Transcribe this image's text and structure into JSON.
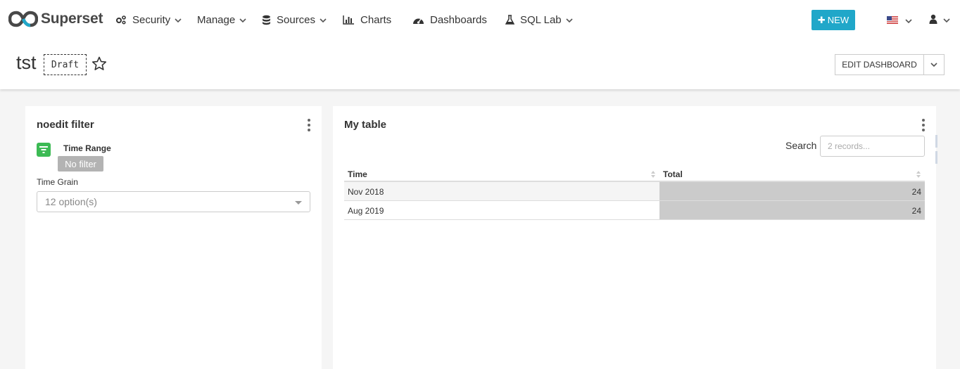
{
  "navbar": {
    "brand": "Superset",
    "items": [
      {
        "label": "Security",
        "icon": "cogs-icon",
        "has_dropdown": true
      },
      {
        "label": "Manage",
        "icon": "",
        "has_dropdown": true
      },
      {
        "label": "Sources",
        "icon": "database-icon",
        "has_dropdown": true
      },
      {
        "label": "Charts",
        "icon": "bar-chart-icon",
        "has_dropdown": false
      },
      {
        "label": "Dashboards",
        "icon": "dashboard-icon",
        "has_dropdown": false
      },
      {
        "label": "SQL Lab",
        "icon": "flask-icon",
        "has_dropdown": true
      }
    ],
    "new_button": "NEW",
    "language": "us-flag-icon",
    "user": "user-icon"
  },
  "dashboard": {
    "title": "tst",
    "status": "Draft",
    "edit_button": "EDIT DASHBOARD"
  },
  "filter_card": {
    "title": "noedit filter",
    "time_range_label": "Time Range",
    "time_range_value": "No filter",
    "time_grain_label": "Time Grain",
    "time_grain_placeholder": "12 option(s)",
    "accent_color": "#3cba54"
  },
  "table_card": {
    "title": "My table",
    "search_label": "Search",
    "search_placeholder": "2 records...",
    "columns": [
      "Time",
      "Total"
    ],
    "rows": [
      {
        "time": "Nov 2018",
        "total": "24"
      },
      {
        "time": "Aug 2019",
        "total": "24"
      }
    ]
  },
  "colors": {
    "new_button": "#20a7c9",
    "bar_fill": "#cbcbcb"
  }
}
